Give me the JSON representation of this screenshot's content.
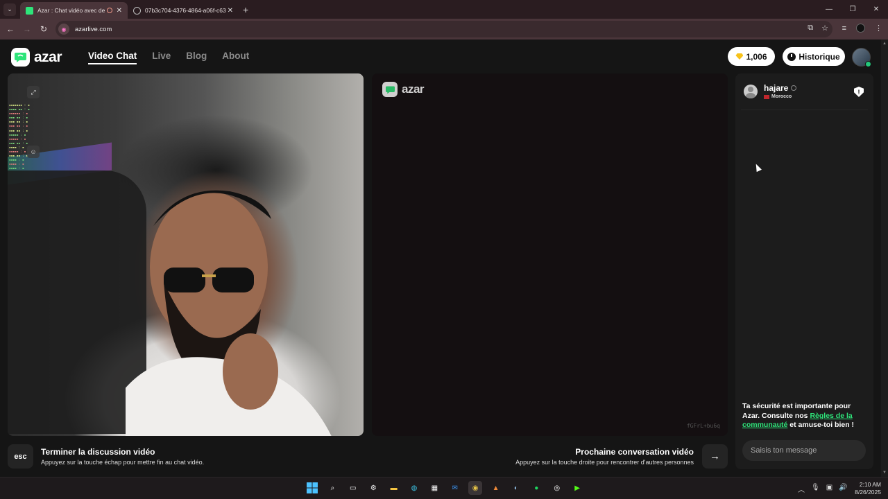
{
  "browser": {
    "tabs": [
      {
        "title": "Azar : Chat vidéo avec de n",
        "active": true
      },
      {
        "title": "07b3c704-4376-4864-a06f-c63",
        "active": false
      }
    ],
    "url": "azarlive.com"
  },
  "header": {
    "logo_text": "azar",
    "nav": [
      {
        "label": "Video Chat",
        "active": true
      },
      {
        "label": "Live",
        "active": false
      },
      {
        "label": "Blog",
        "active": false
      },
      {
        "label": "About",
        "active": false
      }
    ],
    "gems": "1,006",
    "history_label": "Historique"
  },
  "video_center": {
    "watermark": "azar",
    "session_code": "fGFrL+bu6q"
  },
  "chat": {
    "peer_name": "hajare",
    "peer_country": "Morocco",
    "safety_text_1": "Ta sécurité est importante pour Azar. Consulte nos ",
    "safety_link": "Règles de la communauté",
    "safety_text_2": " et amuse-toi bien !",
    "input_placeholder": "Saisis ton message"
  },
  "hints": {
    "esc_key": "esc",
    "end_title": "Terminer la discussion vidéo",
    "end_sub": "Appuyez sur la touche échap pour mettre fin au chat vidéo.",
    "next_title": "Prochaine conversation vidéo",
    "next_sub": "Appuyez sur la touche droite pour rencontrer d'autres personnes"
  },
  "taskbar": {
    "time": "2:10 AM",
    "date": "8/26/2025"
  },
  "colors": {
    "accent_green": "#2ee57a",
    "gem_gold": "#f7c21a"
  }
}
